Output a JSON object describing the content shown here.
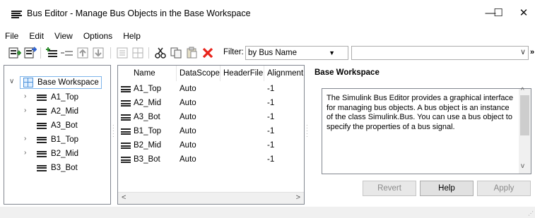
{
  "window": {
    "title": "Bus Editor - Manage Bus Objects in the Base Workspace",
    "minimize": "—",
    "maximize": "☐",
    "close": "✕"
  },
  "menu": [
    "File",
    "Edit",
    "View",
    "Options",
    "Help"
  ],
  "toolbar": {
    "filter_label": "Filter:",
    "filter_mode": "by Bus Name",
    "filter_text": "",
    "overflow": "»"
  },
  "tree": {
    "root": "Base Workspace",
    "items": [
      {
        "label": "A1_Top",
        "expandable": true
      },
      {
        "label": "A2_Mid",
        "expandable": true
      },
      {
        "label": "A3_Bot",
        "expandable": false
      },
      {
        "label": "B1_Top",
        "expandable": true
      },
      {
        "label": "B2_Mid",
        "expandable": true
      },
      {
        "label": "B3_Bot",
        "expandable": false
      }
    ]
  },
  "table": {
    "columns": [
      "Name",
      "DataScope",
      "HeaderFile",
      "Alignment"
    ],
    "rows": [
      [
        "A1_Top",
        "Auto",
        "",
        "-1"
      ],
      [
        "A2_Mid",
        "Auto",
        "",
        "-1"
      ],
      [
        "A3_Bot",
        "Auto",
        "",
        "-1"
      ],
      [
        "B1_Top",
        "Auto",
        "",
        "-1"
      ],
      [
        "B2_Mid",
        "Auto",
        "",
        "-1"
      ],
      [
        "B3_Bot",
        "Auto",
        "",
        "-1"
      ]
    ]
  },
  "properties": {
    "title": "Base Workspace",
    "description": "The Simulink Bus Editor provides a graphical interface for managing bus objects. A bus object is an instance of the class Simulink.Bus. You can use a bus object to specify the properties of a bus signal.",
    "buttons": {
      "revert": "Revert",
      "help": "Help",
      "apply": "Apply"
    }
  },
  "colors": {
    "accent": "#4a90d9",
    "delete": "#e8231b",
    "selection_border": "#7eb4ea"
  }
}
